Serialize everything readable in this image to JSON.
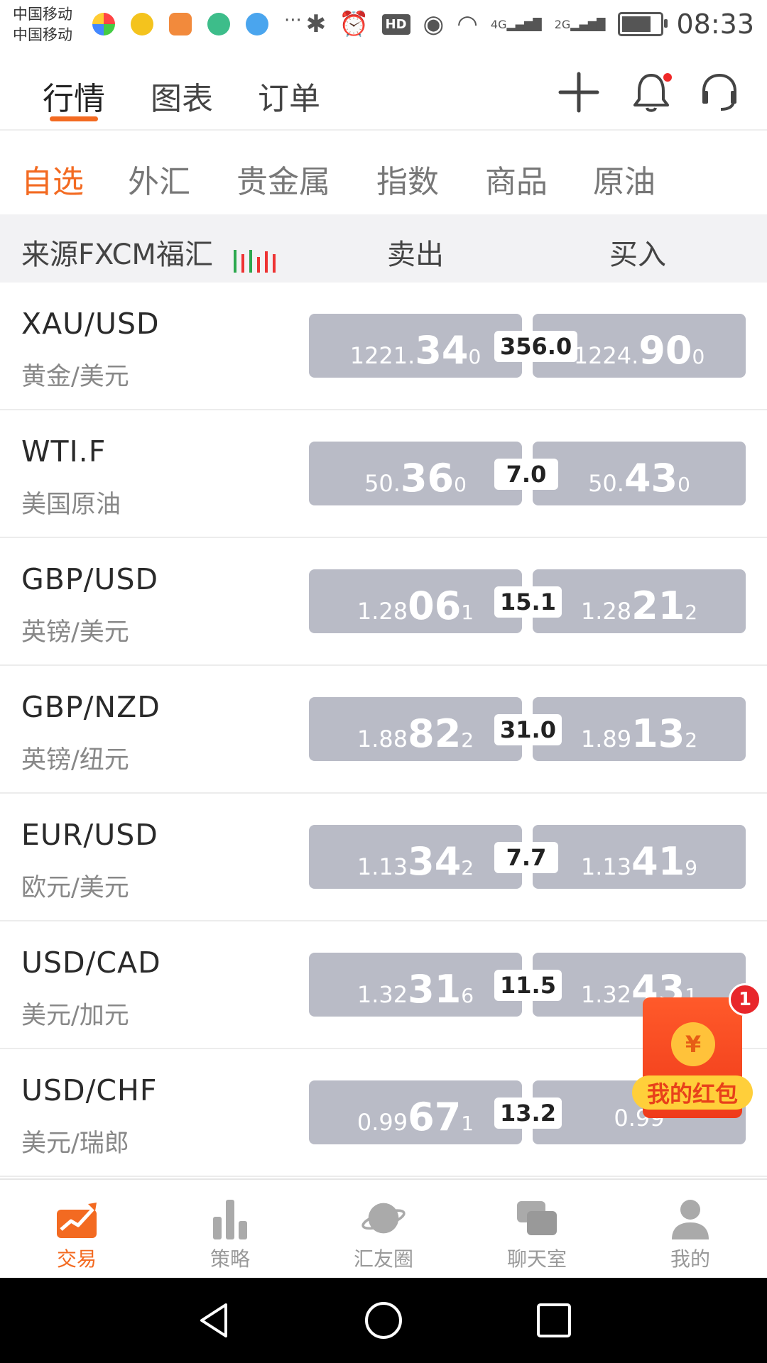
{
  "status_bar": {
    "carrier_1": "中国移动",
    "carrier_2": "中国移动",
    "network_1": "4G",
    "network_2": "2G",
    "hd": "HD",
    "time": "08:33",
    "more": "···"
  },
  "header": {
    "tabs": [
      "行情",
      "图表",
      "订单"
    ],
    "active_tab": 0,
    "accent": "#f36a21"
  },
  "categories": {
    "items": [
      "自选",
      "外汇",
      "贵金属",
      "指数",
      "商品",
      "原油"
    ],
    "active": 0
  },
  "column_header": {
    "source": "来源FXCM福汇",
    "sell": "卖出",
    "buy": "买入"
  },
  "quotes": [
    {
      "symbol": "XAU/USD",
      "name": "黄金/美元",
      "sell": {
        "pre": "1221.",
        "big": "34",
        "suf": "0"
      },
      "spread": "356.0",
      "buy": {
        "pre": "1224.",
        "big": "90",
        "suf": "0"
      }
    },
    {
      "symbol": "WTI.F",
      "name": "美国原油",
      "sell": {
        "pre": "50.",
        "big": "36",
        "suf": "0"
      },
      "spread": "7.0",
      "buy": {
        "pre": "50.",
        "big": "43",
        "suf": "0"
      }
    },
    {
      "symbol": "GBP/USD",
      "name": "英镑/美元",
      "sell": {
        "pre": "1.28",
        "big": "06",
        "suf": "1"
      },
      "spread": "15.1",
      "buy": {
        "pre": "1.28",
        "big": "21",
        "suf": "2"
      }
    },
    {
      "symbol": "GBP/NZD",
      "name": "英镑/纽元",
      "sell": {
        "pre": "1.88",
        "big": "82",
        "suf": "2"
      },
      "spread": "31.0",
      "buy": {
        "pre": "1.89",
        "big": "13",
        "suf": "2"
      }
    },
    {
      "symbol": "EUR/USD",
      "name": "欧元/美元",
      "sell": {
        "pre": "1.13",
        "big": "34",
        "suf": "2"
      },
      "spread": "7.7",
      "buy": {
        "pre": "1.13",
        "big": "41",
        "suf": "9"
      }
    },
    {
      "symbol": "USD/CAD",
      "name": "美元/加元",
      "sell": {
        "pre": "1.32",
        "big": "31",
        "suf": "6"
      },
      "spread": "11.5",
      "buy": {
        "pre": "1.32",
        "big": "43",
        "suf": "1"
      }
    },
    {
      "symbol": "USD/CHF",
      "name": "美元/瑞郎",
      "sell": {
        "pre": "0.99",
        "big": "67",
        "suf": "1"
      },
      "spread": "13.2",
      "buy": {
        "pre": "0.99",
        "big": "",
        "suf": ""
      }
    }
  ],
  "red_packet": {
    "label": "我的红包",
    "badge": "1",
    "coin": "¥"
  },
  "bottom_nav": {
    "items": [
      "交易",
      "策略",
      "汇友圈",
      "聊天室",
      "我的"
    ],
    "active": 0
  }
}
